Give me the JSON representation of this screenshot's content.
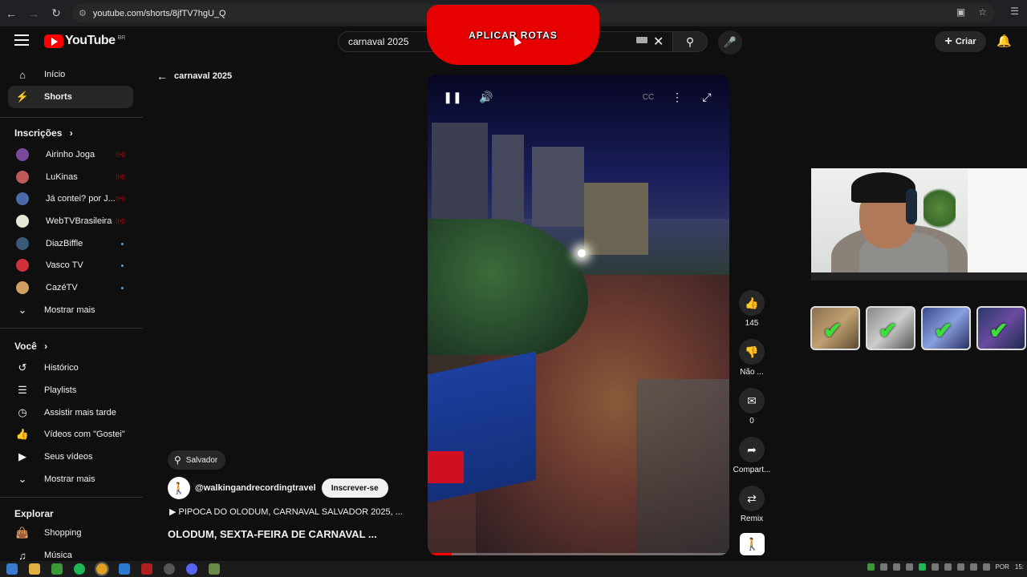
{
  "browser": {
    "url": "youtube.com/shorts/8jfTV7hgU_Q",
    "back_icon": "arrow-left-icon",
    "forward_icon": "arrow-right-icon",
    "reload_icon": "reload-icon"
  },
  "header": {
    "logo_text": "YouTube",
    "country": "BR",
    "search_value": "carnaval 2025",
    "create_label": "Criar",
    "banner_text": "APLICAR ROTAS"
  },
  "sidebar": {
    "main": [
      {
        "label": "Início",
        "icon": "home-icon"
      },
      {
        "label": "Shorts",
        "icon": "shorts-icon"
      }
    ],
    "subs_title": "Inscrições",
    "subs": [
      {
        "label": "Airinho Joga",
        "color": "#7a4a9a",
        "status": "live"
      },
      {
        "label": "LuKinas",
        "color": "#c05a5a",
        "status": "live"
      },
      {
        "label": "Já contei? por J...",
        "color": "#4a6aaa",
        "status": "live"
      },
      {
        "label": "WebTVBrasileira",
        "color": "#e8e8d8",
        "status": "live"
      },
      {
        "label": "DiazBiffle",
        "color": "#3a5a7a",
        "status": "new"
      },
      {
        "label": "Vasco TV",
        "color": "#d0303a",
        "status": "new"
      },
      {
        "label": "CazéTV",
        "color": "#d0a060",
        "status": "new"
      }
    ],
    "subs_more": "Mostrar mais",
    "you_title": "Você",
    "you_items": [
      {
        "label": "Histórico",
        "icon": "history-icon"
      },
      {
        "label": "Playlists",
        "icon": "playlist-icon"
      },
      {
        "label": "Assistir mais tarde",
        "icon": "clock-icon"
      },
      {
        "label": "Vídeos com \"Gostei\"",
        "icon": "thumbs-up-icon"
      },
      {
        "label": "Seus vídeos",
        "icon": "video-icon"
      }
    ],
    "you_more": "Mostrar mais",
    "explore_title": "Explorar",
    "explore_items": [
      {
        "label": "Shopping",
        "icon": "bag-icon"
      },
      {
        "label": "Música",
        "icon": "music-icon"
      }
    ]
  },
  "short": {
    "back_label": "carnaval 2025",
    "likes": "145",
    "dislike_label": "Não ...",
    "comments": "0",
    "share_label": "Compart...",
    "remix_label": "Remix",
    "location": "Salvador",
    "channel": "@walkingandrecordingtravel",
    "subscribe_label": "Inscrever-se",
    "description": "▶ PIPOCA DO OLODUM, CARNAVAL SALVADOR 2025, ...",
    "title": "OLODUM, SEXTA-FEIRA DE CARNAVAL ..."
  },
  "taskbar": {
    "lang": "POR",
    "time": "15:"
  }
}
